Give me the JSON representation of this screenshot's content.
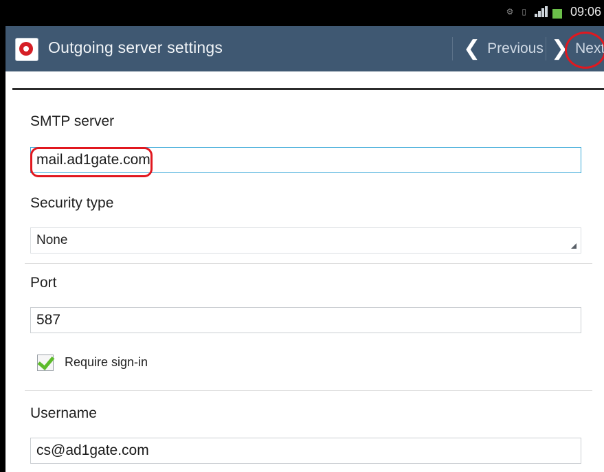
{
  "status_bar": {
    "time": "09:06",
    "icons": [
      "settings-icon",
      "sim-icon",
      "signal-icon",
      "battery-icon"
    ]
  },
  "action_bar": {
    "title": "Outgoing server settings",
    "previous_label": "Previous",
    "next_label": "Next",
    "app_icon": "email-app-icon"
  },
  "form": {
    "smtp_server": {
      "label": "SMTP server",
      "value": "mail.ad1gate.com"
    },
    "security_type": {
      "label": "Security type",
      "selected": "None"
    },
    "port": {
      "label": "Port",
      "value": "587"
    },
    "require_signin": {
      "label": "Require sign-in",
      "checked": true
    },
    "username": {
      "label": "Username",
      "value": "cs@ad1gate.com"
    }
  },
  "colors": {
    "action_bar": "#3f5872",
    "annotation": "#e1181f",
    "checkbox_check": "#5dbb2b",
    "focus_border": "#38a8d8"
  }
}
